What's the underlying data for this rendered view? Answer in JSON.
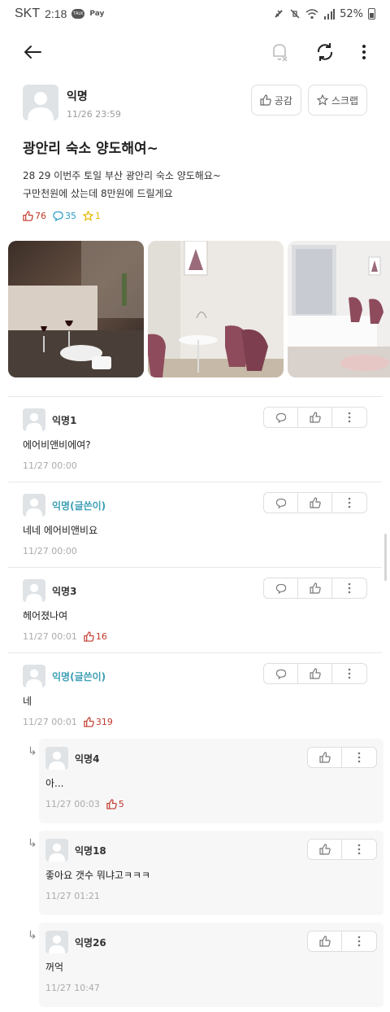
{
  "status": {
    "carrier": "SKT",
    "time": "2:18",
    "talk": "TALK",
    "pay": "Pay",
    "battery": "52%"
  },
  "post": {
    "author": "익명",
    "date": "11/26 23:59",
    "empathy_label": "공감",
    "scrap_label": "스크랩",
    "title": "광안리 숙소 양도해여~",
    "body_line1": "28 29 이번주 토일 부산 광안리 숙소 양도해요~",
    "body_line2": "구만천원에 샀는데 8만원에 드릴게요",
    "likes": "76",
    "comments": "35",
    "scraps": "1"
  },
  "comments": [
    {
      "name": "익명1",
      "text": "에어비앤비에여?",
      "time": "11/27 00:00",
      "likes": ""
    },
    {
      "name": "익명(글쓴이)",
      "text": "네네 에어비앤비요",
      "time": "11/27 00:00",
      "likes": ""
    },
    {
      "name": "익명3",
      "text": "헤어졌나여",
      "time": "11/27 00:01",
      "likes": "16"
    },
    {
      "name": "익명(글쓴이)",
      "text": "네",
      "time": "11/27 00:01",
      "likes": "319"
    }
  ],
  "replies": [
    {
      "name": "익명4",
      "text": "아...",
      "time": "11/27 00:03",
      "likes": "5"
    },
    {
      "name": "익명18",
      "text": "좋아요 갯수 뭐냐고ㅋㅋㅋ",
      "time": "11/27 01:21",
      "likes": ""
    },
    {
      "name": "익명26",
      "text": "꺼억",
      "time": "11/27 10:47",
      "likes": ""
    }
  ],
  "colors": {
    "op_name": "#3c9fb4",
    "like_red": "#c0392b",
    "comment_teal": "#2a9bc8",
    "scrap_gold": "#e6b800"
  }
}
